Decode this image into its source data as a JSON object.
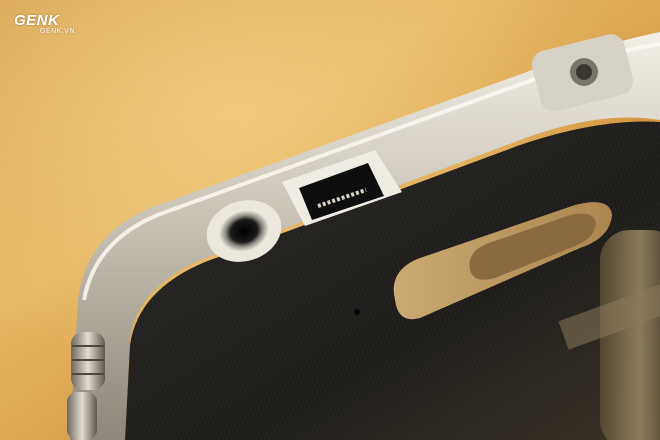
{
  "watermark": {
    "logo_text": "GENK",
    "site_text": "GENK.VN"
  },
  "colors": {
    "background_warm": "#d69a45",
    "background_light": "#e8bd6e",
    "body_dark": "#232221",
    "metal_frame": "#cfc9bd",
    "metal_highlight": "#f4f1ea",
    "port_dark": "#0e0e0e"
  },
  "scene": {
    "subject": "camera-top-edge-closeup"
  }
}
